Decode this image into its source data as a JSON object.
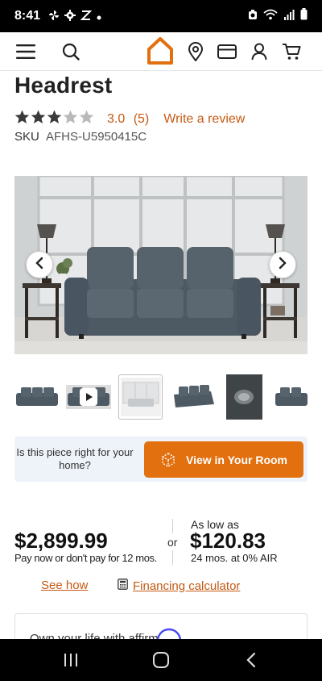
{
  "status_bar": {
    "time": "8:41",
    "left_icons": [
      "pinwheel-icon",
      "gear-icon",
      "sync-icon",
      "dot-icon"
    ],
    "right_icons": [
      "alarm-icon",
      "wifi-icon",
      "signal-icon",
      "battery-icon"
    ]
  },
  "header": {
    "icons": [
      "menu-icon",
      "search-icon",
      "logo-house-icon",
      "location-icon",
      "card-icon",
      "account-icon",
      "cart-icon"
    ],
    "brand_color": "#e2700f"
  },
  "product": {
    "title_partial": "Headrest",
    "rating": {
      "stars_filled": 3,
      "stars_total": 5,
      "value_text": "3.0",
      "count_text": "(5)",
      "write_review": "Write a review"
    },
    "sku_label": "SKU",
    "sku_value": "AFHS-U5950415C"
  },
  "gallery": {
    "prev_icon": "chevron-left-icon",
    "next_icon": "chevron-right-icon",
    "thumbnails": [
      {
        "kind": "sofa-image",
        "selected": false
      },
      {
        "kind": "video",
        "selected": false
      },
      {
        "kind": "room-image",
        "selected": true
      },
      {
        "kind": "sofa-image",
        "selected": false
      },
      {
        "kind": "control-button-image",
        "selected": false
      },
      {
        "kind": "sofa-image",
        "selected": false
      }
    ]
  },
  "room_banner": {
    "question": "Is this piece right for your home?",
    "button_label": "View in Your Room",
    "button_icon": "ar-cube-icon"
  },
  "pricing": {
    "price": "$2,899.99",
    "price_terms": "Pay now or don't pay for 12 mos.",
    "or": "or",
    "as_low_as": "As low as",
    "monthly_price": "$120.83",
    "monthly_terms": "24 mos. at 0% AIR"
  },
  "links": {
    "see_how": "See how",
    "financing_calculator": "Financing calculator"
  },
  "affirm_card": {
    "text_partial": "Own your life with affirm"
  },
  "android_nav": [
    "recents-icon",
    "home-icon",
    "back-icon"
  ],
  "colors": {
    "accent": "#e2700f",
    "link": "#c45a14",
    "banner_bg": "#eef3f9"
  }
}
